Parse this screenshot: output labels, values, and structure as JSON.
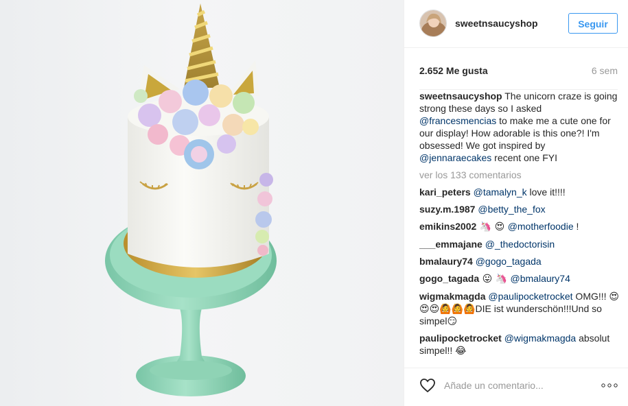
{
  "post": {
    "username": "sweetnsaucyshop",
    "follow_label": "Seguir",
    "likes": "2.652 Me gusta",
    "age": "6 sem"
  },
  "caption": {
    "username": "sweetnsaucyshop",
    "text1": " The unicorn craze is going strong these days so I asked ",
    "mention1": "@francesmencias",
    "text2": " to make me a cute one for our display! How adorable is this one?! I'm obsessed! We got inspired by ",
    "mention2": "@jennaraecakes",
    "text3": " recent one FYI"
  },
  "view_more": "ver los 133 comentarios",
  "comments": [
    {
      "user": "kari_peters",
      "mention": "@tamalyn_k",
      "after": " love it!!!!"
    },
    {
      "user": "suzy.m.1987",
      "mention": "@betty_the_fox"
    },
    {
      "user": "emikins2002",
      "emoji": " 🦄 😍 ",
      "mention": "@motherfoodie",
      "after": " !"
    },
    {
      "user": "___emmajane",
      "mention": "@_thedoctorisin"
    },
    {
      "user": "bmalaury74",
      "mention": "@gogo_tagada"
    },
    {
      "user": "gogo_tagada",
      "emoji": " 😛 🦄 ",
      "mention": "@bmalaury74"
    },
    {
      "user": "wigmakmagda",
      "mention": "@paulipocketrocket",
      "after": " OMG!!! 😍😍😍🙆🙆🙆DIE ist wunderschön!!!Und so simpel😏"
    },
    {
      "user": "paulipocketrocket",
      "mention": "@wigmakmagda",
      "after": " absolut simpel!! 😂"
    }
  ],
  "add_comment_placeholder": "Añade un comentario...",
  "icons": {
    "like": "heart-icon",
    "options": "more-options-icon"
  },
  "colors": {
    "accent": "#3897f0",
    "mention": "#003569",
    "muted": "#999999"
  }
}
